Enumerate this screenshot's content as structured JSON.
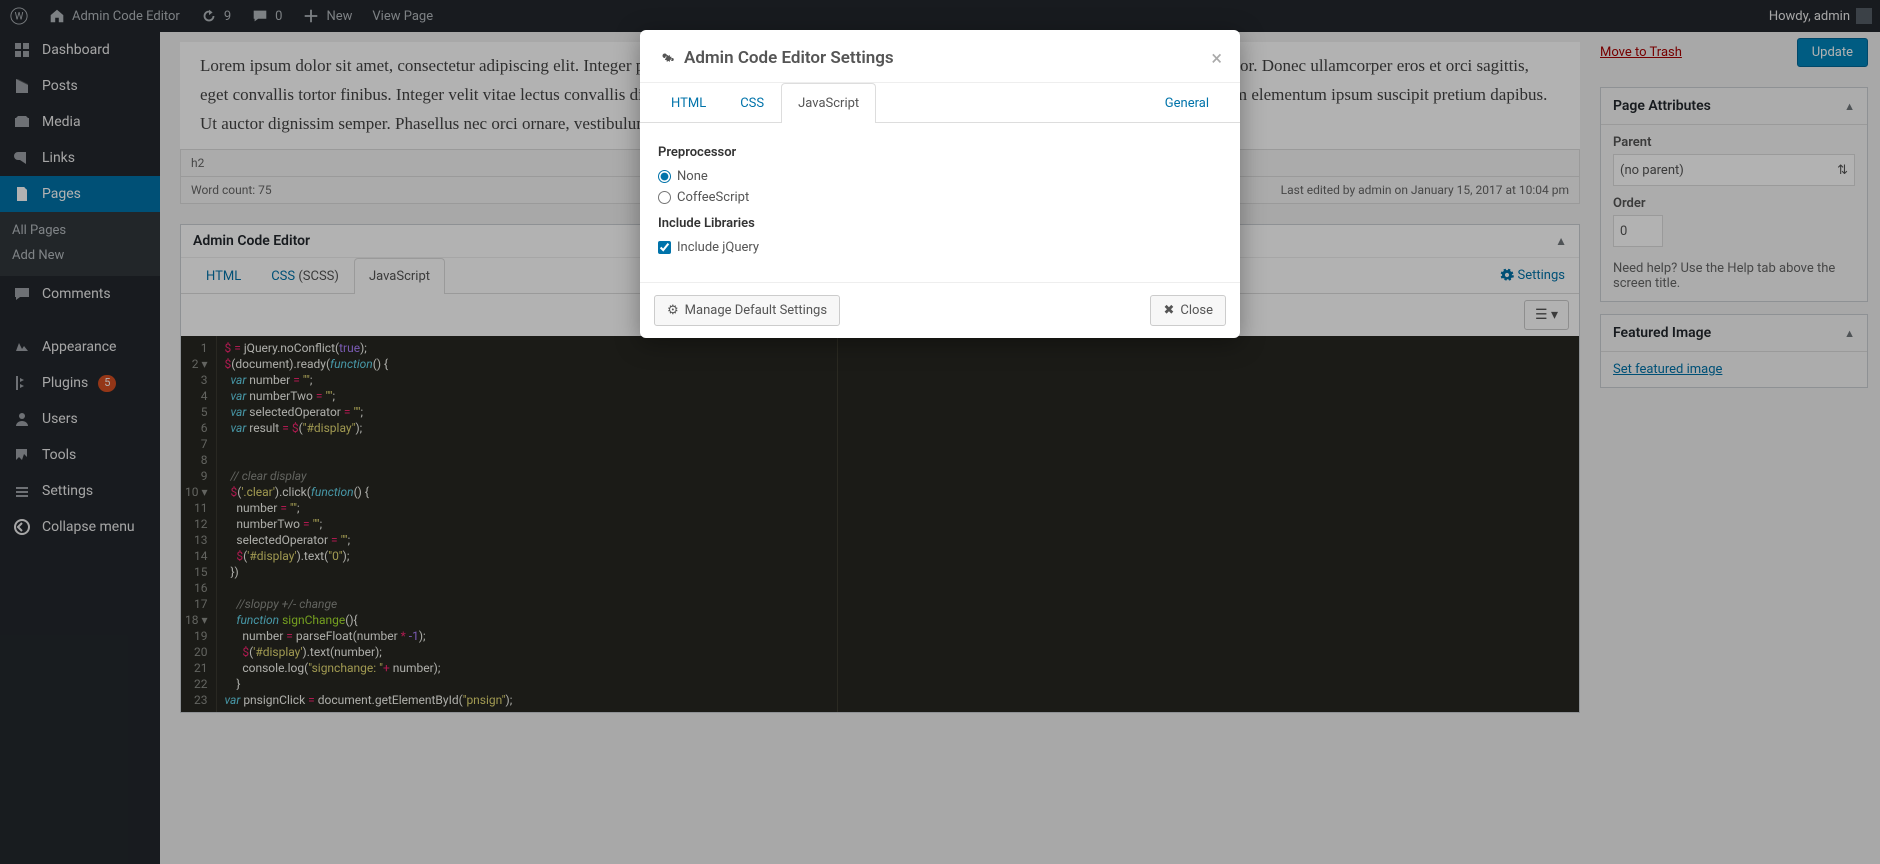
{
  "adminbar": {
    "site_name": "Admin Code Editor",
    "revisions_count": "9",
    "comments_count": "0",
    "new_label": "New",
    "view_page": "View Page",
    "howdy": "Howdy, admin"
  },
  "sidebar": {
    "items": [
      {
        "label": "Dashboard"
      },
      {
        "label": "Posts"
      },
      {
        "label": "Media"
      },
      {
        "label": "Links"
      },
      {
        "label": "Pages",
        "current": true
      },
      {
        "label": "Comments"
      },
      {
        "label": "Appearance"
      },
      {
        "label": "Plugins",
        "badge": "5"
      },
      {
        "label": "Users"
      },
      {
        "label": "Tools"
      },
      {
        "label": "Settings"
      },
      {
        "label": "Collapse menu"
      }
    ],
    "submenu_pages": [
      "All Pages",
      "Add New"
    ]
  },
  "editor": {
    "body_text": "Lorem ipsum dolor sit amet, consectetur adipiscing elit. Integer pellentesque, arcu nec elementum feugiat, quam dolor suscipit. Cras placerat ultrices tortor. Donec ullamcorper eros et orci sagittis, eget convallis tortor finibus. Integer velit vitae lectus convallis dignissim vel et dolor. Maecenas a dolor ut diam semper accumsan tristique a est. Aliquam elementum ipsum suscipit pretium dapibus. Ut auctor dignissim semper. Phasellus nec orci ornare, vestibulum dolor ut, mollis commodo vel id massa. Duis maximus sit amet maximus rhoncus.",
    "path": "h2",
    "wordcount_label": "Word count: 75",
    "last_edited": "Last edited by admin on January 15, 2017 at 10:04 pm"
  },
  "ace_box": {
    "title": "Admin Code Editor",
    "tabs": [
      "HTML",
      "CSS (SCSS)",
      "JavaScript"
    ],
    "tabs_plain": {
      "html": "HTML",
      "css_pre": "CSS",
      "css_suf": " (SCSS)",
      "js": "JavaScript"
    },
    "settings_label": "Settings"
  },
  "code_lines": [
    {
      "n": "1",
      "html": "<span class='tok-dl'>$</span> <span class='tok-op'>=</span> <span class='tok-id'>jQuery.noConflict(</span><span class='tok-num'>true</span><span class='tok-id'>);</span>"
    },
    {
      "n": "2",
      "fold": true,
      "html": "<span class='tok-dl'>$</span><span class='tok-id'>(document).ready(</span><span class='tok-fn'>function</span><span class='tok-id'>() {</span>"
    },
    {
      "n": "3",
      "html": "  <span class='tok-kw'>var</span> <span class='tok-id'>number</span> <span class='tok-op'>=</span> <span class='tok-str'>\"\"</span><span class='tok-id'>;</span>"
    },
    {
      "n": "4",
      "html": "  <span class='tok-kw'>var</span> <span class='tok-id'>numberTwo</span> <span class='tok-op'>=</span> <span class='tok-str'>\"\"</span><span class='tok-id'>;</span>"
    },
    {
      "n": "5",
      "html": "  <span class='tok-kw'>var</span> <span class='tok-id'>selectedOperator</span> <span class='tok-op'>=</span> <span class='tok-str'>\"\"</span><span class='tok-id'>;</span>"
    },
    {
      "n": "6",
      "html": "  <span class='tok-kw'>var</span> <span class='tok-id'>result</span> <span class='tok-op'>=</span> <span class='tok-dl'>$</span><span class='tok-id'>(</span><span class='tok-str'>\"#display\"</span><span class='tok-id'>);</span>"
    },
    {
      "n": "7",
      "html": ""
    },
    {
      "n": "8",
      "html": ""
    },
    {
      "n": "9",
      "html": "  <span class='tok-cm'>// clear display</span>"
    },
    {
      "n": "10",
      "fold": true,
      "html": "  <span class='tok-dl'>$</span><span class='tok-id'>(</span><span class='tok-str'>'.clear'</span><span class='tok-id'>).click(</span><span class='tok-fn'>function</span><span class='tok-id'>() {</span>"
    },
    {
      "n": "11",
      "html": "    <span class='tok-id'>number</span> <span class='tok-op'>=</span> <span class='tok-str'>\"\"</span><span class='tok-id'>;</span>"
    },
    {
      "n": "12",
      "html": "    <span class='tok-id'>numberTwo</span> <span class='tok-op'>=</span> <span class='tok-str'>\"\"</span><span class='tok-id'>;</span>"
    },
    {
      "n": "13",
      "html": "    <span class='tok-id'>selectedOperator</span> <span class='tok-op'>=</span> <span class='tok-str'>\"\"</span><span class='tok-id'>;</span>"
    },
    {
      "n": "14",
      "html": "    <span class='tok-dl'>$</span><span class='tok-id'>(</span><span class='tok-str'>'#display'</span><span class='tok-id'>).text(</span><span class='tok-str'>\"0\"</span><span class='tok-id'>);</span>"
    },
    {
      "n": "15",
      "html": "  <span class='tok-id'>})</span>"
    },
    {
      "n": "16",
      "html": ""
    },
    {
      "n": "17",
      "html": "    <span class='tok-cm'>//sloppy +/- change</span>"
    },
    {
      "n": "18",
      "fold": true,
      "html": "    <span class='tok-fn'>function</span> <span class='tok-var'>signChange</span><span class='tok-id'>(){</span>"
    },
    {
      "n": "19",
      "html": "      <span class='tok-id'>number</span> <span class='tok-op'>=</span> <span class='tok-id'>parseFloat(number</span> <span class='tok-op'>*</span> <span class='tok-num'>-1</span><span class='tok-id'>);</span>"
    },
    {
      "n": "20",
      "html": "      <span class='tok-dl'>$</span><span class='tok-id'>(</span><span class='tok-str'>'#display'</span><span class='tok-id'>).text(number);</span>"
    },
    {
      "n": "21",
      "html": "      <span class='tok-id'>console.log(</span><span class='tok-str'>\"signchange: \"</span><span class='tok-op'>+</span> <span class='tok-id'>number);</span>"
    },
    {
      "n": "22",
      "html": "    <span class='tok-id'>}</span>"
    },
    {
      "n": "23",
      "html": "<span class='tok-kw'>var</span> <span class='tok-id'>pnsignClick</span> <span class='tok-op'>=</span> <span class='tok-id'>document.getElementById(</span><span class='tok-str'>\"pnsign\"</span><span class='tok-id'>);</span>"
    }
  ],
  "sidepanels": {
    "trash": "Move to Trash",
    "update": "Update",
    "page_attributes_title": "Page Attributes",
    "parent_label": "Parent",
    "parent_value": "(no parent)",
    "order_label": "Order",
    "order_value": "0",
    "help_text": "Need help? Use the Help tab above the screen title.",
    "featured_title": "Featured Image",
    "set_featured": "Set featured image"
  },
  "modal": {
    "title": "Admin Code Editor Settings",
    "tabs": {
      "html": "HTML",
      "css": "CSS",
      "js": "JavaScript",
      "general": "General"
    },
    "preprocessor_label": "Preprocessor",
    "opt_none": "None",
    "opt_coffee": "CoffeeScript",
    "include_lib_label": "Include Libraries",
    "include_jquery": "Include jQuery",
    "manage_defaults": "Manage Default Settings",
    "close": "Close"
  }
}
